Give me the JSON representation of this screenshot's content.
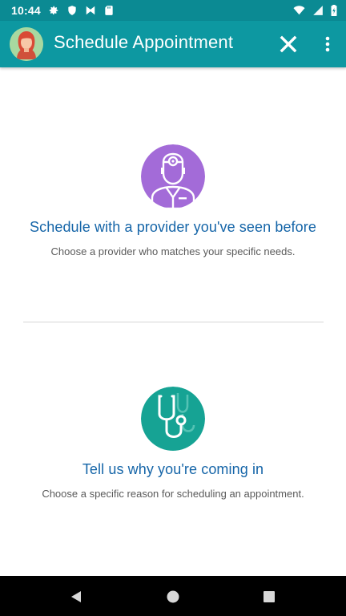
{
  "status_bar": {
    "time": "10:44",
    "left_icons": [
      "gear-icon",
      "shield-icon",
      "butterfly-icon",
      "sd-card-icon"
    ],
    "right_icons": [
      "wifi-icon",
      "signal-icon",
      "battery-icon"
    ]
  },
  "app_bar": {
    "title": "Schedule Appointment",
    "avatar": "user-avatar",
    "close_icon": "close-icon",
    "more_icon": "more-vertical-icon",
    "color": "#0d98a1"
  },
  "options": [
    {
      "heading": "Schedule with a provider you've seen before",
      "description": "Choose a provider who matches your specific needs.",
      "icon": "doctor-icon",
      "icon_color": "#a36bd8"
    },
    {
      "heading": "Tell us why you're coming in",
      "description": "Choose a specific reason for scheduling an appointment.",
      "icon": "stethoscope-icon",
      "icon_color": "#16a394"
    }
  ],
  "nav_bar": {
    "buttons": [
      "back-icon",
      "home-icon",
      "recents-icon"
    ]
  },
  "colors": {
    "heading": "#1565a8",
    "description": "#5a5a5a",
    "status_bar": "#0b8a93"
  }
}
